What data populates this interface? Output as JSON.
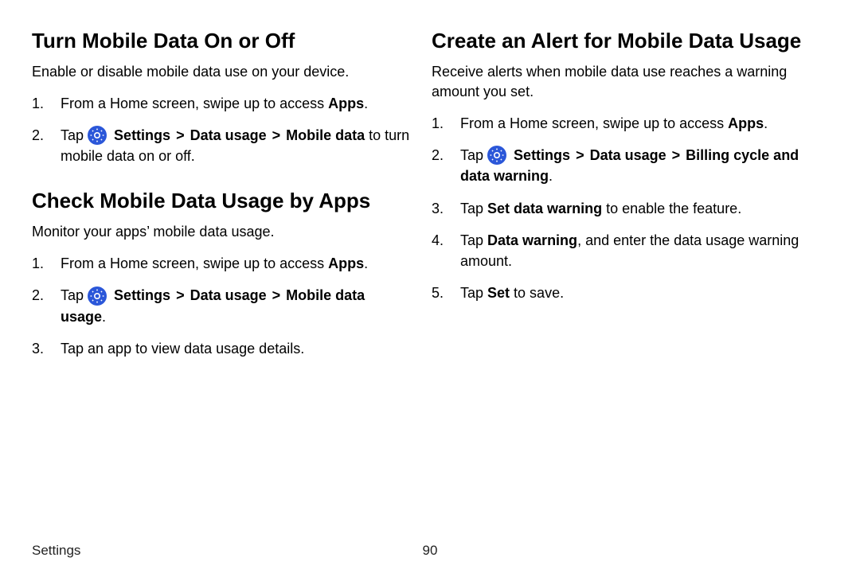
{
  "left": {
    "section1": {
      "heading": "Turn Mobile Data On or Off",
      "intro": "Enable or disable mobile data use on your device.",
      "steps": {
        "s1_pre": "From a Home screen, swipe up to access ",
        "s1_b": "Apps",
        "s1_post": ".",
        "s2_pre": "Tap ",
        "s2_b1": "Settings",
        "s2_sep1": " > ",
        "s2_b2": "Data usage",
        "s2_sep2": " > ",
        "s2_b3": "Mobile data",
        "s2_post": " to turn mobile data on or off."
      }
    },
    "section2": {
      "heading": "Check Mobile Data Usage by Apps",
      "intro": "Monitor your apps’ mobile data usage.",
      "steps": {
        "s1_pre": "From a Home screen, swipe up to access ",
        "s1_b": "Apps",
        "s1_post": ".",
        "s2_pre": "Tap ",
        "s2_b1": "Settings",
        "s2_sep1": " > ",
        "s2_b2": "Data usage",
        "s2_sep2": " > ",
        "s2_b3": "Mobile data usage",
        "s2_post": ".",
        "s3": "Tap an app to view data usage details."
      }
    }
  },
  "right": {
    "section1": {
      "heading": "Create an Alert for Mobile Data Usage",
      "intro": "Receive alerts when mobile data use reaches a warning amount you set.",
      "steps": {
        "s1_pre": "From a Home screen, swipe up to access ",
        "s1_b": "Apps",
        "s1_post": ".",
        "s2_pre": "Tap ",
        "s2_b1": "Settings",
        "s2_sep1": " > ",
        "s2_b2": "Data usage",
        "s2_sep2": " > ",
        "s2_b3": "Billing cycle and data warning",
        "s2_post": ".",
        "s3_pre": "Tap ",
        "s3_b": "Set data warning",
        "s3_post": " to enable the feature.",
        "s4_pre": "Tap ",
        "s4_b": "Data warning",
        "s4_post": ", and enter the data usage warning amount.",
        "s5_pre": "Tap ",
        "s5_b": "Set",
        "s5_post": " to save."
      }
    }
  },
  "footer": {
    "section": "Settings",
    "page": "90"
  }
}
